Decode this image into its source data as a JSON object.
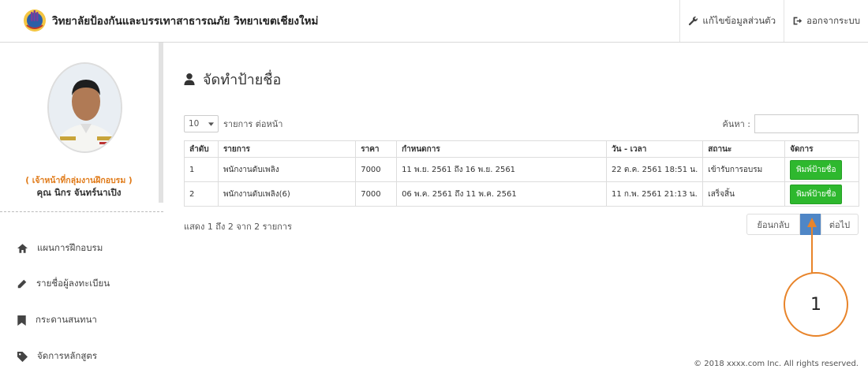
{
  "header": {
    "brand_title": "วิทยาลัยป้องกันและบรรเทาสาธารณภัย วิทยาเขตเชียงใหม่",
    "edit_profile": "แก้ไขข้อมูลส่วนตัว",
    "logout": "ออกจากระบบ",
    "icons": {
      "edit_profile": "wrench-icon",
      "logout": "sign-out-icon"
    }
  },
  "sidebar": {
    "role": "( เจ้าหน้าที่กลุ่มงานฝึกอบรม )",
    "user_name": "คุณ นิกร จันทร์นาเปิง",
    "items": [
      {
        "label": "แผนการฝึกอบรม",
        "icon": "home-icon"
      },
      {
        "label": "รายชื่อผู้ลงทะเบียน",
        "icon": "pencil-icon"
      },
      {
        "label": "กระดานสนทนา",
        "icon": "bookmark-icon"
      },
      {
        "label": "จัดการหลักสูตร",
        "icon": "tag-icon"
      }
    ]
  },
  "main": {
    "title": "จัดทำป้ายชื่อ",
    "title_icon": "user-icon",
    "page_length": {
      "value": "10",
      "suffix": "รายการ ต่อหน้า"
    },
    "search_label": "ค้นหา :",
    "columns": [
      "ลำดับ",
      "รายการ",
      "ราคา",
      "กำหนดการ",
      "วัน - เวลา",
      "สถานะ",
      "จัดการ"
    ],
    "rows": [
      {
        "no": "1",
        "item": "พนักงานดับเพลิง",
        "price": "7000",
        "schedule": "11 พ.ย. 2561 ถึง 16 พ.ย. 2561",
        "datetime": "22 ต.ค. 2561 18:51 น.",
        "status": "เข้ารับการอบรม",
        "action": "พิมพ์ป้ายชื่อ"
      },
      {
        "no": "2",
        "item": "พนักงานดับเพลิง(6)",
        "price": "7000",
        "schedule": "06 พ.ค. 2561 ถึง 11 พ.ค. 2561",
        "datetime": "11 ก.พ. 2561 21:13 น.",
        "status": "เสร็จสิ้น",
        "action": "พิมพ์ป้ายชื่อ"
      }
    ],
    "info": "แสดง 1 ถึง 2 จาก 2 รายการ",
    "pager": {
      "prev": "ย้อนกลับ",
      "next": "ต่อไป"
    }
  },
  "annotation": {
    "label": "1",
    "color": "#e8842a"
  },
  "footer": "© 2018 xxxx.com Inc. All rights reserved.",
  "colors": {
    "accent_green": "#2eb82e",
    "page_active": "#4f86c6",
    "role_orange": "#e07b1a"
  }
}
